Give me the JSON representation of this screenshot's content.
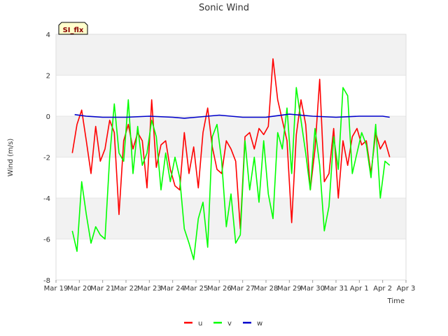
{
  "chart_data": {
    "type": "line",
    "title": "Sonic Wind",
    "xlabel": "Time",
    "ylabel": "Wind (m/s)",
    "badge": "SI_flx",
    "xlim": [
      "Mar 19",
      "Apr 3"
    ],
    "ylim": [
      -8,
      4
    ],
    "x_ticks": [
      "Mar 19",
      "Mar 20",
      "Mar 21",
      "Mar 22",
      "Mar 23",
      "Mar 24",
      "Mar 25",
      "Mar 26",
      "Mar 27",
      "Mar 28",
      "Mar 29",
      "Mar 30",
      "Mar 31",
      "Apr 1",
      "Apr 2",
      "Apr 3"
    ],
    "y_ticks": [
      -8,
      -6,
      -4,
      -2,
      0,
      2,
      4
    ],
    "grid": true,
    "legend_position": "bottom",
    "colors": {
      "u": "#ff0000",
      "v": "#00ff00",
      "w": "#0000cc",
      "band": "#f2f2f2",
      "badge_bg": "#ffffcc"
    },
    "x_unit": "days since Mar 19",
    "series": [
      {
        "name": "u",
        "x": [
          0.7,
          0.9,
          1.1,
          1.3,
          1.5,
          1.7,
          1.9,
          2.1,
          2.3,
          2.5,
          2.7,
          2.9,
          3.1,
          3.3,
          3.5,
          3.7,
          3.9,
          4.1,
          4.3,
          4.5,
          4.7,
          4.9,
          5.1,
          5.3,
          5.5,
          5.7,
          5.9,
          6.1,
          6.3,
          6.5,
          6.7,
          6.9,
          7.1,
          7.3,
          7.5,
          7.7,
          7.9,
          8.1,
          8.3,
          8.5,
          8.7,
          8.9,
          9.1,
          9.3,
          9.5,
          9.7,
          9.9,
          10.1,
          10.3,
          10.5,
          10.7,
          10.9,
          11.1,
          11.3,
          11.5,
          11.7,
          11.9,
          12.1,
          12.3,
          12.5,
          12.7,
          12.9,
          13.1,
          13.3,
          13.5,
          13.7,
          13.9,
          14.1,
          14.3
        ],
        "values": [
          -1.8,
          -0.4,
          0.3,
          -1.2,
          -2.8,
          -0.5,
          -2.2,
          -1.6,
          -0.2,
          -0.8,
          -4.8,
          -1.2,
          -0.4,
          -1.6,
          -0.8,
          -1.2,
          -3.5,
          0.8,
          -2.5,
          -1.4,
          -1.2,
          -2.6,
          -3.4,
          -3.6,
          -0.8,
          -2.8,
          -1.5,
          -3.5,
          -0.8,
          0.4,
          -1.5,
          -2.6,
          -2.8,
          -1.2,
          -1.6,
          -2.2,
          -5.5,
          -1.0,
          -0.8,
          -1.6,
          -0.6,
          -0.9,
          -0.5,
          2.8,
          0.8,
          -0.2,
          -1.2,
          -5.2,
          -0.9,
          0.8,
          -0.4,
          -3.6,
          -1.6,
          1.8,
          -3.2,
          -2.8,
          -0.6,
          -4.0,
          -1.2,
          -2.4,
          -1.0,
          -0.6,
          -1.4,
          -1.2,
          -2.8,
          -0.8,
          -1.6,
          -1.2,
          -2.0
        ]
      },
      {
        "name": "v",
        "x": [
          0.7,
          0.9,
          1.1,
          1.3,
          1.5,
          1.7,
          1.9,
          2.1,
          2.3,
          2.5,
          2.7,
          2.9,
          3.1,
          3.3,
          3.5,
          3.7,
          3.9,
          4.1,
          4.3,
          4.5,
          4.7,
          4.9,
          5.1,
          5.3,
          5.5,
          5.7,
          5.9,
          6.1,
          6.3,
          6.5,
          6.7,
          6.9,
          7.1,
          7.3,
          7.5,
          7.7,
          7.9,
          8.1,
          8.3,
          8.5,
          8.7,
          8.9,
          9.1,
          9.3,
          9.5,
          9.7,
          9.9,
          10.1,
          10.3,
          10.5,
          10.7,
          10.9,
          11.1,
          11.3,
          11.5,
          11.7,
          11.9,
          12.1,
          12.3,
          12.5,
          12.7,
          12.9,
          13.1,
          13.3,
          13.5,
          13.7,
          13.9,
          14.1,
          14.3
        ],
        "values": [
          -5.6,
          -6.6,
          -3.2,
          -4.8,
          -6.2,
          -5.4,
          -5.8,
          -6.0,
          -2.0,
          0.6,
          -1.8,
          -2.2,
          0.8,
          -2.8,
          -0.5,
          -2.4,
          -1.8,
          -0.2,
          -1.0,
          -3.6,
          -1.8,
          -3.2,
          -2.0,
          -3.0,
          -5.5,
          -6.2,
          -7.0,
          -5.0,
          -4.2,
          -6.4,
          -1.0,
          -0.4,
          -2.2,
          -5.4,
          -3.8,
          -6.2,
          -5.8,
          -1.2,
          -3.6,
          -2.0,
          -4.2,
          -1.2,
          -3.8,
          -5.0,
          -0.8,
          -1.6,
          0.4,
          -2.8,
          1.4,
          -0.2,
          -1.8,
          -3.6,
          -0.6,
          -2.4,
          -5.6,
          -4.4,
          -1.0,
          -2.6,
          1.4,
          1.0,
          -2.8,
          -1.8,
          -0.8,
          -1.4,
          -3.0,
          -0.4,
          -4.0,
          -2.2,
          -2.4
        ]
      },
      {
        "name": "w",
        "x": [
          0.8,
          1.3,
          2.0,
          3.0,
          4.0,
          5.0,
          5.5,
          6.0,
          7.0,
          8.0,
          9.0,
          10.0,
          11.0,
          12.0,
          13.0,
          14.0,
          14.3
        ],
        "values": [
          0.08,
          0.0,
          -0.05,
          -0.05,
          0.0,
          -0.05,
          -0.1,
          -0.05,
          0.05,
          -0.05,
          -0.05,
          0.1,
          0.0,
          -0.05,
          0.0,
          0.0,
          -0.05
        ]
      }
    ]
  }
}
